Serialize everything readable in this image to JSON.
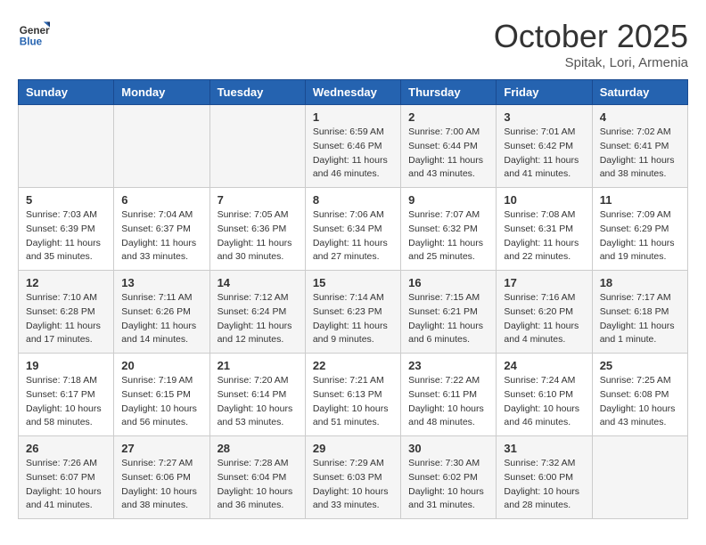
{
  "header": {
    "logo_line1": "General",
    "logo_line2": "Blue",
    "month": "October 2025",
    "location": "Spitak, Lori, Armenia"
  },
  "weekdays": [
    "Sunday",
    "Monday",
    "Tuesday",
    "Wednesday",
    "Thursday",
    "Friday",
    "Saturday"
  ],
  "weeks": [
    [
      {
        "day": "",
        "info": ""
      },
      {
        "day": "",
        "info": ""
      },
      {
        "day": "",
        "info": ""
      },
      {
        "day": "1",
        "info": "Sunrise: 6:59 AM\nSunset: 6:46 PM\nDaylight: 11 hours\nand 46 minutes."
      },
      {
        "day": "2",
        "info": "Sunrise: 7:00 AM\nSunset: 6:44 PM\nDaylight: 11 hours\nand 43 minutes."
      },
      {
        "day": "3",
        "info": "Sunrise: 7:01 AM\nSunset: 6:42 PM\nDaylight: 11 hours\nand 41 minutes."
      },
      {
        "day": "4",
        "info": "Sunrise: 7:02 AM\nSunset: 6:41 PM\nDaylight: 11 hours\nand 38 minutes."
      }
    ],
    [
      {
        "day": "5",
        "info": "Sunrise: 7:03 AM\nSunset: 6:39 PM\nDaylight: 11 hours\nand 35 minutes."
      },
      {
        "day": "6",
        "info": "Sunrise: 7:04 AM\nSunset: 6:37 PM\nDaylight: 11 hours\nand 33 minutes."
      },
      {
        "day": "7",
        "info": "Sunrise: 7:05 AM\nSunset: 6:36 PM\nDaylight: 11 hours\nand 30 minutes."
      },
      {
        "day": "8",
        "info": "Sunrise: 7:06 AM\nSunset: 6:34 PM\nDaylight: 11 hours\nand 27 minutes."
      },
      {
        "day": "9",
        "info": "Sunrise: 7:07 AM\nSunset: 6:32 PM\nDaylight: 11 hours\nand 25 minutes."
      },
      {
        "day": "10",
        "info": "Sunrise: 7:08 AM\nSunset: 6:31 PM\nDaylight: 11 hours\nand 22 minutes."
      },
      {
        "day": "11",
        "info": "Sunrise: 7:09 AM\nSunset: 6:29 PM\nDaylight: 11 hours\nand 19 minutes."
      }
    ],
    [
      {
        "day": "12",
        "info": "Sunrise: 7:10 AM\nSunset: 6:28 PM\nDaylight: 11 hours\nand 17 minutes."
      },
      {
        "day": "13",
        "info": "Sunrise: 7:11 AM\nSunset: 6:26 PM\nDaylight: 11 hours\nand 14 minutes."
      },
      {
        "day": "14",
        "info": "Sunrise: 7:12 AM\nSunset: 6:24 PM\nDaylight: 11 hours\nand 12 minutes."
      },
      {
        "day": "15",
        "info": "Sunrise: 7:14 AM\nSunset: 6:23 PM\nDaylight: 11 hours\nand 9 minutes."
      },
      {
        "day": "16",
        "info": "Sunrise: 7:15 AM\nSunset: 6:21 PM\nDaylight: 11 hours\nand 6 minutes."
      },
      {
        "day": "17",
        "info": "Sunrise: 7:16 AM\nSunset: 6:20 PM\nDaylight: 11 hours\nand 4 minutes."
      },
      {
        "day": "18",
        "info": "Sunrise: 7:17 AM\nSunset: 6:18 PM\nDaylight: 11 hours\nand 1 minute."
      }
    ],
    [
      {
        "day": "19",
        "info": "Sunrise: 7:18 AM\nSunset: 6:17 PM\nDaylight: 10 hours\nand 58 minutes."
      },
      {
        "day": "20",
        "info": "Sunrise: 7:19 AM\nSunset: 6:15 PM\nDaylight: 10 hours\nand 56 minutes."
      },
      {
        "day": "21",
        "info": "Sunrise: 7:20 AM\nSunset: 6:14 PM\nDaylight: 10 hours\nand 53 minutes."
      },
      {
        "day": "22",
        "info": "Sunrise: 7:21 AM\nSunset: 6:13 PM\nDaylight: 10 hours\nand 51 minutes."
      },
      {
        "day": "23",
        "info": "Sunrise: 7:22 AM\nSunset: 6:11 PM\nDaylight: 10 hours\nand 48 minutes."
      },
      {
        "day": "24",
        "info": "Sunrise: 7:24 AM\nSunset: 6:10 PM\nDaylight: 10 hours\nand 46 minutes."
      },
      {
        "day": "25",
        "info": "Sunrise: 7:25 AM\nSunset: 6:08 PM\nDaylight: 10 hours\nand 43 minutes."
      }
    ],
    [
      {
        "day": "26",
        "info": "Sunrise: 7:26 AM\nSunset: 6:07 PM\nDaylight: 10 hours\nand 41 minutes."
      },
      {
        "day": "27",
        "info": "Sunrise: 7:27 AM\nSunset: 6:06 PM\nDaylight: 10 hours\nand 38 minutes."
      },
      {
        "day": "28",
        "info": "Sunrise: 7:28 AM\nSunset: 6:04 PM\nDaylight: 10 hours\nand 36 minutes."
      },
      {
        "day": "29",
        "info": "Sunrise: 7:29 AM\nSunset: 6:03 PM\nDaylight: 10 hours\nand 33 minutes."
      },
      {
        "day": "30",
        "info": "Sunrise: 7:30 AM\nSunset: 6:02 PM\nDaylight: 10 hours\nand 31 minutes."
      },
      {
        "day": "31",
        "info": "Sunrise: 7:32 AM\nSunset: 6:00 PM\nDaylight: 10 hours\nand 28 minutes."
      },
      {
        "day": "",
        "info": ""
      }
    ]
  ]
}
